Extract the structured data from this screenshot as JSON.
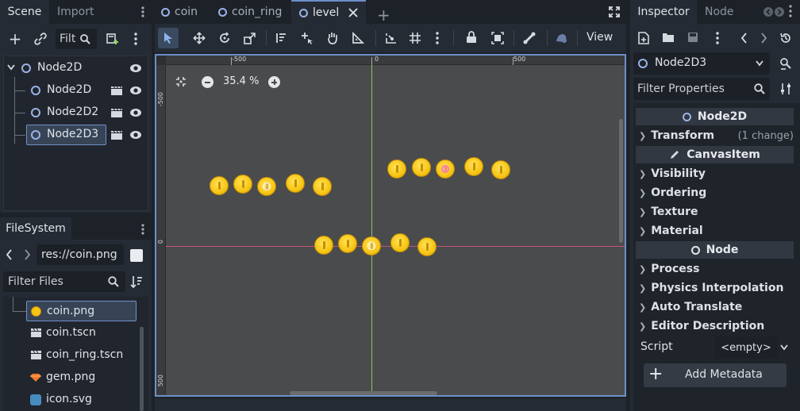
{
  "scene_dock": {
    "tabs": [
      "Scene",
      "Import"
    ],
    "filter_placeholder": "Filt",
    "tree": [
      {
        "label": "Node2D",
        "depth": 0
      },
      {
        "label": "Node2D",
        "depth": 1
      },
      {
        "label": "Node2D2",
        "depth": 1
      },
      {
        "label": "Node2D3",
        "depth": 1,
        "selected": true
      }
    ]
  },
  "filesystem": {
    "tab": "FileSystem",
    "path": "res://coin.png",
    "filter_placeholder": "Filter Files",
    "files": [
      {
        "name": "coin.png",
        "icon": "coin-icon",
        "selected": true
      },
      {
        "name": "coin.tscn",
        "icon": "clapperboard-icon"
      },
      {
        "name": "coin_ring.tscn",
        "icon": "clapperboard-icon"
      },
      {
        "name": "gem.png",
        "icon": "gem-icon"
      },
      {
        "name": "icon.svg",
        "icon": "godot-icon"
      }
    ]
  },
  "editor_tabs": [
    {
      "label": "coin",
      "active": false
    },
    {
      "label": "coin_ring",
      "active": false
    },
    {
      "label": "level",
      "active": true
    }
  ],
  "toolbar": {
    "view_label": "View"
  },
  "canvas": {
    "zoom": "35.4 %",
    "ruler_top": [
      "-500",
      "0",
      "500"
    ],
    "ruler_left": [
      "-500",
      "0",
      "500"
    ]
  },
  "inspector": {
    "tabs": [
      "Inspector",
      "Node"
    ],
    "selected_node": "Node2D3",
    "filter_placeholder": "Filter Properties",
    "sections": {
      "node2d": "Node2D",
      "transform": "Transform",
      "transform_note": "(1 change)",
      "canvas_item": "CanvasItem",
      "visibility": "Visibility",
      "ordering": "Ordering",
      "texture": "Texture",
      "material": "Material",
      "node": "Node",
      "process": "Process",
      "physics": "Physics Interpolation",
      "auto_translate": "Auto Translate",
      "editor_desc": "Editor Description"
    },
    "script_label": "Script",
    "script_value": "<empty>",
    "add_metadata": "Add Metadata"
  },
  "colors": {
    "accent": "#6d8fc8",
    "node_circle": "#9ab3e6",
    "coin": "#f7c514",
    "axis_x": "#c2577a",
    "axis_y": "#8fc35a"
  }
}
